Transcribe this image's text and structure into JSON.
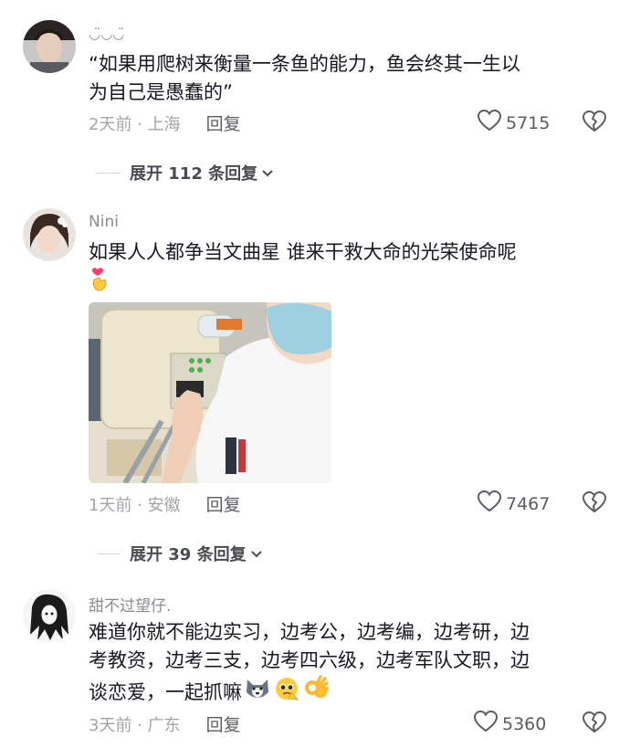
{
  "comments": [
    {
      "username": "◡̈◡◡̈",
      "text_line1": "“如果用爬树来衡量一条鱼的能力，鱼会终其一生以",
      "text_line2": "为自己是愚蠢的”",
      "meta": "2天前 · 上海",
      "reply_label": "回复",
      "likes": "5715",
      "expand_label": "展开 112 条回复"
    },
    {
      "username": "Nini",
      "text": "如果人人都争当文曲星  谁来干救大命的光荣使命呢",
      "meta": "1天前 · 安徽",
      "reply_label": "回复",
      "likes": "7467",
      "expand_label": "展开 39 条回复"
    },
    {
      "username": "甜不过望仔.",
      "text_line1": "难道你就不能边实习，边考公，边考编，边考研，边",
      "text_line2": "考教资，边考三支，边考四六级，边考军队文职，边",
      "text_line3": "谈恋爱，一起抓嘛",
      "meta": "3天前 · 广东",
      "reply_label": "回复",
      "likes": "5360"
    }
  ],
  "colors": {
    "text": "#161823",
    "secondary": "#a3a4a9",
    "icon": "#5c5d63"
  },
  "icons": [
    "heart-outline-icon",
    "broken-heart-icon",
    "chevron-down-icon",
    "heart-hands-emoji",
    "husky-emoji",
    "pleading-face-emoji",
    "ok-hand-emoji"
  ]
}
